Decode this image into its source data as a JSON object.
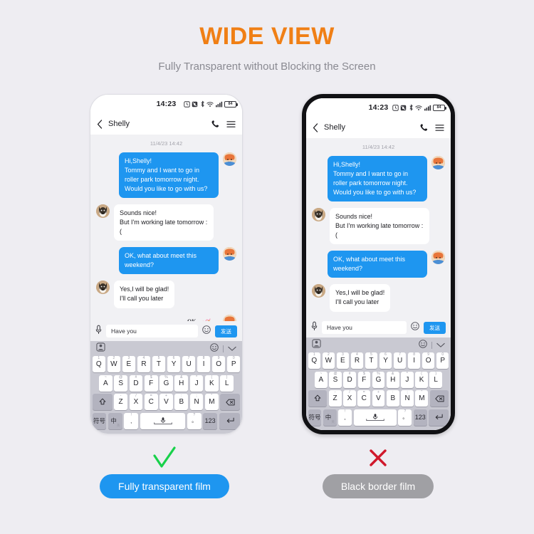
{
  "header": {
    "title": "WIDE VIEW",
    "subtitle": "Fully Transparent without Blocking the Screen",
    "title_color": "#f07f15",
    "subtitle_color": "#8a8a92"
  },
  "background_color": "#eeedf2",
  "phone": {
    "status": {
      "time": "14:23",
      "battery_level": "84",
      "icons": [
        "alarm-icon",
        "mute-icon",
        "bluetooth-icon",
        "wifi-icon",
        "signal-icon",
        "battery-icon"
      ]
    },
    "appbar": {
      "back_icon": "chevron-left-icon",
      "contact_name": "Shelly",
      "call_icon": "phone-icon",
      "menu_icon": "hamburger-menu-icon"
    },
    "chat": {
      "datestamp": "11/4/23 14:42",
      "messages": [
        {
          "side": "out",
          "text": "Hi,Shelly!\nTommy and I want to go in roller park tomorrow night. Would you like to go with us?"
        },
        {
          "side": "in",
          "text": "Sounds nice!\nBut I'm working late tomorrow :("
        },
        {
          "side": "out",
          "text": "OK, what about meet this weekend?"
        },
        {
          "side": "in",
          "text": "Yes,I will be glad!\nI'll call you later"
        }
      ],
      "sticker": {
        "label": "OK",
        "name": "ok-gesture-sticker"
      },
      "bubble_out_color": "#1e96f0",
      "bubble_in_color": "#ffffff"
    },
    "input": {
      "mic_icon": "microphone-icon",
      "value": "Have you",
      "emoji_icon": "smiley-icon",
      "send_label": "发送"
    },
    "keyboard": {
      "toolbar": {
        "sticker_icon": "sticker-pack-icon",
        "emoji_icon": "smiley-icon",
        "collapse_icon": "chevron-down-icon"
      },
      "row1": [
        {
          "key": "Q",
          "sup": "1"
        },
        {
          "key": "W",
          "sup": "2"
        },
        {
          "key": "E",
          "sup": "3"
        },
        {
          "key": "R",
          "sup": "4"
        },
        {
          "key": "T",
          "sup": "5"
        },
        {
          "key": "Y",
          "sup": "6"
        },
        {
          "key": "U",
          "sup": "7"
        },
        {
          "key": "I",
          "sup": "8"
        },
        {
          "key": "O",
          "sup": "9"
        },
        {
          "key": "P",
          "sup": "0"
        }
      ],
      "row2": [
        {
          "key": "A",
          "sup": "~"
        },
        {
          "key": "S",
          "sup": "@"
        },
        {
          "key": "D",
          "sup": "#"
        },
        {
          "key": "F",
          "sup": "$"
        },
        {
          "key": "G",
          "sup": "%"
        },
        {
          "key": "H",
          "sup": "&"
        },
        {
          "key": "J",
          "sup": "*"
        },
        {
          "key": "K",
          "sup": "("
        },
        {
          "key": "L",
          "sup": ")"
        }
      ],
      "row3": [
        {
          "key": "Z",
          "sup": "-"
        },
        {
          "key": "X",
          "sup": "/"
        },
        {
          "key": "C",
          "sup": "="
        },
        {
          "key": "V",
          "sup": "+"
        },
        {
          "key": "B",
          "sup": ":"
        },
        {
          "key": "N",
          "sup": ";"
        },
        {
          "key": "M",
          "sup": "\""
        }
      ],
      "shift_icon": "shift-arrow-icon",
      "backspace_icon": "backspace-icon",
      "row4": {
        "symbols": "符号",
        "lang": "中",
        "lang_sub": "英",
        "comma": ",",
        "comma_sup": "!",
        "space_icon": "microphone-space-icon",
        "period": "。",
        "period_sup": "?",
        "numbers": "123",
        "enter_icon": "enter-arrow-icon"
      }
    }
  },
  "comparison": {
    "left": {
      "mark": "check-mark",
      "mark_symbol": "√",
      "mark_color": "#18d14b",
      "label": "Fully transparent film",
      "pill_color": "#1e96f0"
    },
    "right": {
      "mark": "cross-mark",
      "mark_symbol": "✕",
      "mark_color": "#d0182b",
      "label": "Black border film",
      "pill_color": "#a0a0a4"
    }
  }
}
